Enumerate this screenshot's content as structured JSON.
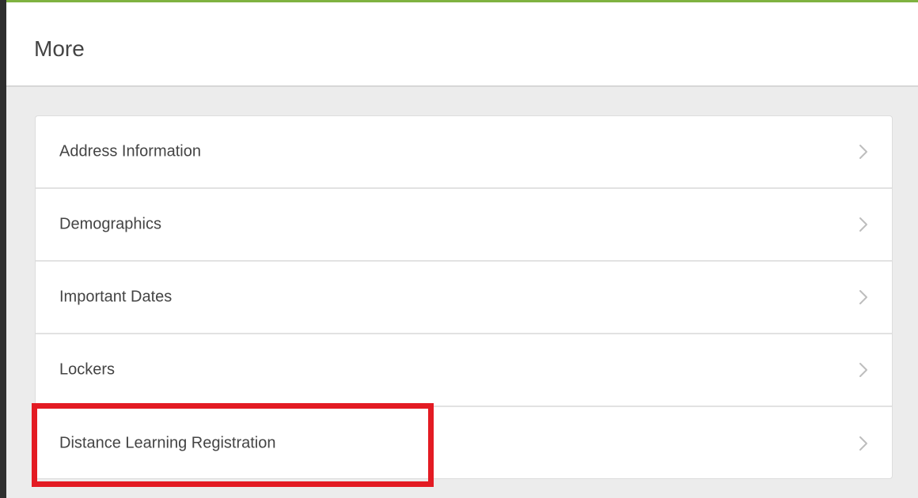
{
  "header": {
    "title": "More"
  },
  "items": [
    {
      "label": "Address Information",
      "icon": "chevron-right-icon"
    },
    {
      "label": "Demographics",
      "icon": "chevron-right-icon"
    },
    {
      "label": "Important Dates",
      "icon": "chevron-right-icon"
    },
    {
      "label": "Lockers",
      "icon": "chevron-right-icon"
    },
    {
      "label": "Distance Learning Registration",
      "icon": "chevron-right-icon"
    }
  ],
  "colors": {
    "accent": "#7fb241",
    "highlight": "#e31b23",
    "page_background": "#ececec",
    "text": "#444444"
  }
}
